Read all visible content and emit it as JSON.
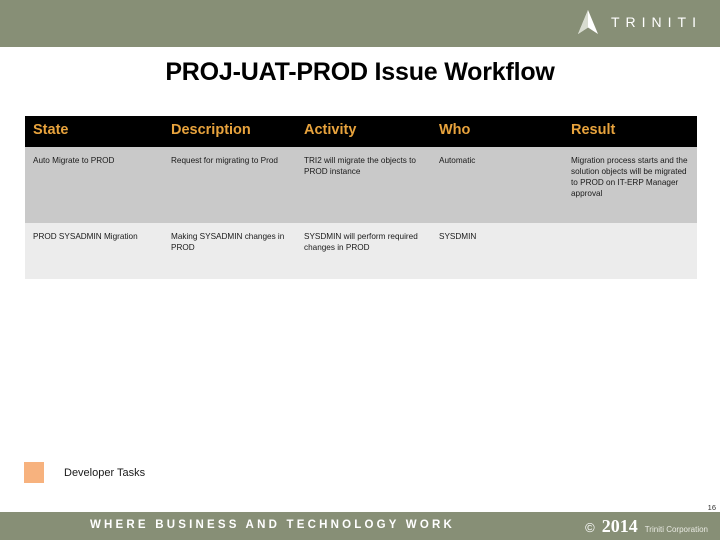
{
  "header": {
    "brand_name": "TRINITI",
    "brand_mark": "triniti-triangle-logo",
    "band_color": "#878f76"
  },
  "slide": {
    "title": "PROJ-UAT-PROD Issue Workflow",
    "page_number": "16"
  },
  "table": {
    "header_bg": "#000000",
    "header_text_color": "#e8a33d",
    "columns": [
      {
        "key": "state",
        "label": "State"
      },
      {
        "key": "description",
        "label": "Description"
      },
      {
        "key": "activity",
        "label": "Activity"
      },
      {
        "key": "who",
        "label": "Who"
      },
      {
        "key": "result",
        "label": "Result"
      }
    ],
    "rows": [
      {
        "state": "Auto Migrate to PROD",
        "description": "Request for migrating to Prod",
        "activity": "TRI2 will migrate the objects to PROD instance",
        "who": "Automatic",
        "result": "Migration process starts and the solution objects will be migrated to PROD on IT-ERP Manager approval",
        "row_bg": "#c9c9c9"
      },
      {
        "state": "PROD SYSADMIN Migration",
        "description": "Making SYSADMIN changes in PROD",
        "activity": "SYSDMIN will perform required changes in PROD",
        "who": "SYSDMIN",
        "result": "",
        "row_bg": "#ececec"
      }
    ]
  },
  "legend": {
    "items": [
      {
        "label": "Developer Tasks",
        "color": "#f7b27e"
      }
    ]
  },
  "footer": {
    "tagline": "WHERE BUSINESS AND TECHNOLOGY WORK",
    "copyright_symbol": "©",
    "copyright_year": "2014",
    "company": "Triniti Corporation",
    "band_color": "#878f76"
  }
}
